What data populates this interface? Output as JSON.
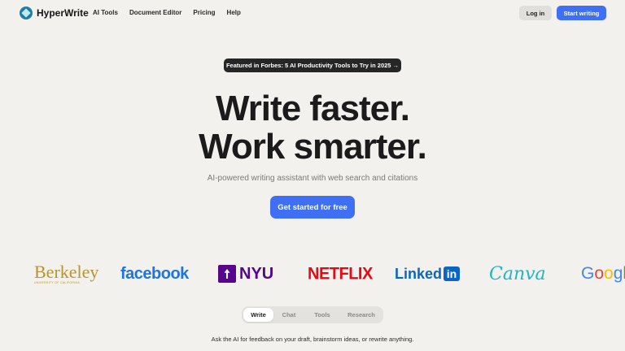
{
  "nav": {
    "brand": "HyperWrite",
    "links": [
      "AI Tools",
      "Document Editor",
      "Pricing",
      "Help"
    ],
    "login_label": "Log in",
    "start_label": "Start writing"
  },
  "badge": {
    "text": "Featured in Forbes: 5 AI Productivity Tools to Try in 2025 →"
  },
  "hero": {
    "line1": "Write faster.",
    "line2": "Work smarter.",
    "subtitle": "AI-powered writing assistant with web search and citations",
    "cta_label": "Get started for free"
  },
  "logos": {
    "berkeley": "Berkeley",
    "berkeley_sub": "UNIVERSITY OF CALIFORNIA",
    "facebook": "facebook",
    "nyu": "NYU",
    "netflix": "NETFLIX",
    "linkedin": "Linked",
    "linkedin_box": "in",
    "canva": "Canva",
    "google_letters": [
      "G",
      "o",
      "o",
      "g",
      "l"
    ]
  },
  "tabs": {
    "items": [
      "Write",
      "Chat",
      "Tools",
      "Research"
    ],
    "active": "Write"
  },
  "caption": "Ask the AI for feedback on your draft, brainstorm ideas, or rewrite anything.",
  "colors": {
    "background": "#f2f1ee",
    "accent": "#3f6ff2",
    "badge_bg": "#262626"
  }
}
